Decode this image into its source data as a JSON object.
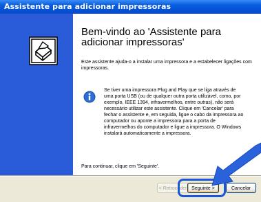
{
  "window": {
    "title": "Assistente para adicionar impressoras"
  },
  "banner": {
    "icon": "printer-wizard-icon"
  },
  "content": {
    "heading": "Bem-vindo ao 'Assistente para adicionar impressoras'",
    "intro": "Este assistente ajuda-o a instalar uma impressora e a estabelecer ligações com impressoras.",
    "info_icon": "info-icon",
    "info_text": "Se tiver uma impressora Plug and Play que se liga através de uma porta USB (ou de qualquer outra porta utilizável, como, por exemplo, IEEE 1394, infravermelhos, entre outras), não será necessário utilizar este assistente. Clique em 'Cancelar' para fechar o assistente e, em seguida, ligue o cabo da impressora ao computador ou aponte a impressora para a porta de infravermelhos do computador e ligue a impressora. O Windows instalará automaticamente a impressora.",
    "continue_text": "Para continuar, clique em 'Seguinte'."
  },
  "buttons": {
    "back_label": "< Retroceder",
    "next_label": "Seguinte >",
    "cancel_label": "Cancelar"
  },
  "colors": {
    "titlebar": "#0a5fe0",
    "banner": "#2a5bd8",
    "highlight": "#1a56d8"
  }
}
